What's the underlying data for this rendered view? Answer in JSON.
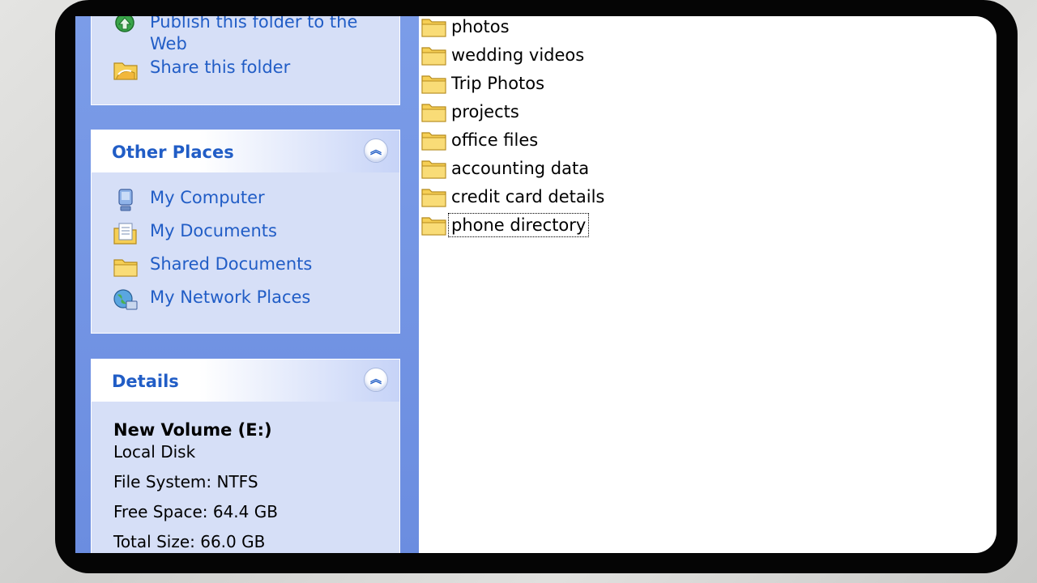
{
  "file_tasks": {
    "items": [
      {
        "label": "Publish this folder to the\nWeb",
        "icon": "publish-web-icon"
      },
      {
        "label": "Share this folder",
        "icon": "share-folder-icon"
      }
    ]
  },
  "other_places": {
    "title": "Other Places",
    "items": [
      {
        "label": "My Computer",
        "icon": "my-computer-icon"
      },
      {
        "label": "My Documents",
        "icon": "my-documents-icon"
      },
      {
        "label": "Shared Documents",
        "icon": "folder-icon"
      },
      {
        "label": "My Network Places",
        "icon": "network-places-icon"
      }
    ]
  },
  "details": {
    "title": "Details",
    "name": "New Volume (E:)",
    "type": "Local Disk",
    "file_system": "File System: NTFS",
    "free_space": "Free Space: 64.4 GB",
    "total_size": "Total Size: 66.0 GB"
  },
  "folders": [
    {
      "name": "photos"
    },
    {
      "name": "wedding videos"
    },
    {
      "name": "Trip Photos"
    },
    {
      "name": "projects"
    },
    {
      "name": "office files"
    },
    {
      "name": "accounting data"
    },
    {
      "name": "credit card details"
    },
    {
      "name": "phone directory"
    }
  ],
  "colors": {
    "link": "#215dc6",
    "pane": "#7b9ce8",
    "box": "#d6dff7",
    "folder": "#f6cf55"
  }
}
